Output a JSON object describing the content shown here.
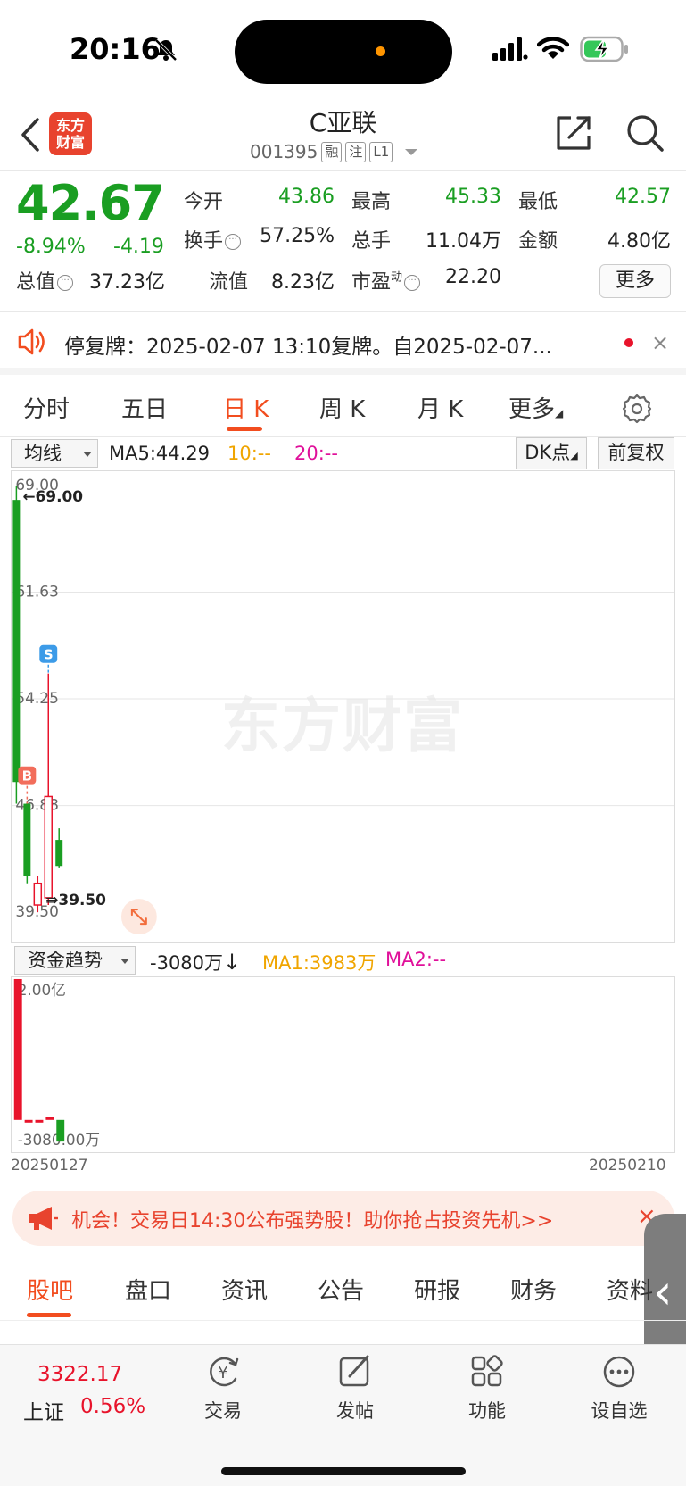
{
  "status_bar": {
    "time": "20:16"
  },
  "header": {
    "logo_line1": "东方",
    "logo_line2": "财富",
    "title": "C亚联",
    "code": "001395",
    "tags": [
      "融",
      "注",
      "L1"
    ]
  },
  "quote": {
    "price": "42.67",
    "change_pct": "-8.94%",
    "change_amt": "-4.19",
    "fields": [
      {
        "label": "今开",
        "value": "43.86"
      },
      {
        "label": "最高",
        "value": "45.33"
      },
      {
        "label": "最低",
        "value": "42.57"
      },
      {
        "label": "换手",
        "value": "57.25%"
      },
      {
        "label": "总手",
        "value": "11.04万"
      },
      {
        "label": "金额",
        "value": "4.80亿"
      },
      {
        "label": "总值",
        "value": "37.23亿"
      },
      {
        "label": "流值",
        "value": "8.23亿"
      },
      {
        "label": "市盈",
        "sup": "动",
        "value": "22.20"
      }
    ],
    "more_label": "更多"
  },
  "notice": {
    "text": "停复牌：2025-02-07 13:10复牌。自2025-02-07...",
    "close": "×"
  },
  "tabs": [
    "分时",
    "五日",
    "日 K",
    "周 K",
    "月 K",
    "更多"
  ],
  "active_tab": "日 K",
  "chart_header": {
    "indicator_select": "均线",
    "ma5": "MA5:44.29",
    "ma10": "10:--",
    "ma20": "20:--",
    "dk_button": "DK点",
    "adjust_button": "前复权"
  },
  "chart_data": [
    {
      "type": "candlestick",
      "y_ticks": [
        "69.00",
        "61.63",
        "54.25",
        "46.88",
        "39.50"
      ],
      "ylim": [
        39.5,
        69.0
      ],
      "max_label": "69.00",
      "min_label": "39.50",
      "markers": [
        {
          "label": "B",
          "candle_index": 1
        },
        {
          "label": "S",
          "candle_index": 3
        }
      ],
      "candles": [
        {
          "open": 68.0,
          "high": 69.0,
          "low": 47.0,
          "close": 48.5,
          "color": "green"
        },
        {
          "open": 47.0,
          "high": 47.0,
          "low": 41.5,
          "close": 42.0,
          "color": "green"
        },
        {
          "open": 40.0,
          "high": 42.0,
          "low": 39.5,
          "close": 41.5,
          "color": "red"
        },
        {
          "open": 40.5,
          "high": 56.0,
          "low": 40.0,
          "close": 47.5,
          "color": "red"
        },
        {
          "open": 44.5,
          "high": 45.3,
          "low": 42.6,
          "close": 42.7,
          "color": "green"
        }
      ],
      "colors": {
        "up": "#e8132b",
        "down": "#1a9e22"
      }
    },
    {
      "type": "bar",
      "title": "资金趋势",
      "current": "-3080万",
      "ma1": "MA1:3983万",
      "ma2": "MA2:--",
      "y_ticks": [
        "2.00亿",
        "-3080.00万"
      ],
      "ylim": [
        -3080,
        20000
      ],
      "values": [
        20000,
        -300,
        -300,
        400,
        -3080
      ],
      "colors": [
        "#e8132b",
        "#e8132b",
        "#e8132b",
        "#e8132b",
        "#1a9e22"
      ],
      "x_start": "20250127",
      "x_end": "20250210"
    }
  ],
  "promo": {
    "text": "机会！交易日14:30公布强势股！助你抢占投资先机>>",
    "close": "×"
  },
  "side_handle": "‹",
  "bottom_tabs": [
    "股吧",
    "盘口",
    "资讯",
    "公告",
    "研报",
    "财务",
    "资料"
  ],
  "bottom_bar": {
    "index_value": "3322.17",
    "index_name": "上证",
    "index_change": "0.56%",
    "tools": [
      {
        "label": "交易",
        "icon": "trade-icon"
      },
      {
        "label": "发帖",
        "icon": "post-icon"
      },
      {
        "label": "功能",
        "icon": "function-icon"
      },
      {
        "label": "设自选",
        "icon": "watchlist-icon"
      }
    ]
  }
}
